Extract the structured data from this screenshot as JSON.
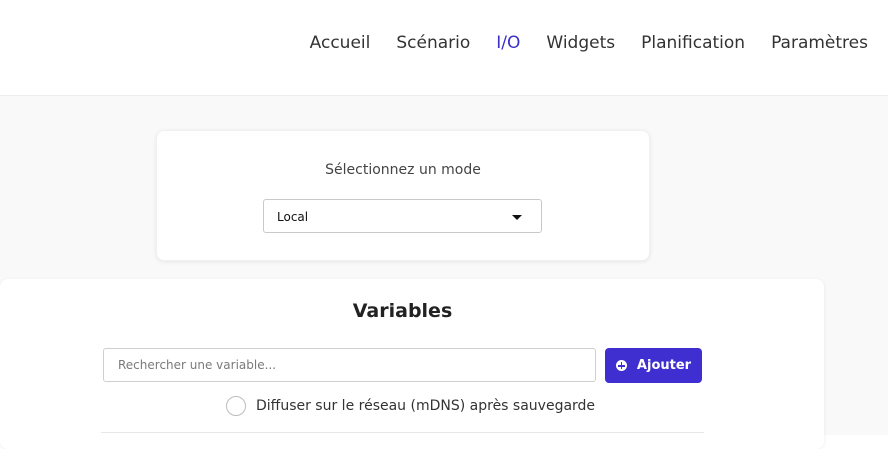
{
  "nav": {
    "items": [
      {
        "label": "Accueil"
      },
      {
        "label": "Scénario"
      },
      {
        "label": "I/O"
      },
      {
        "label": "Widgets"
      },
      {
        "label": "Planification"
      },
      {
        "label": "Paramètres"
      }
    ],
    "active": "I/O"
  },
  "mode": {
    "label": "Sélectionnez un mode",
    "selected": "Local"
  },
  "variables": {
    "title": "Variables",
    "search_placeholder": "Rechercher une variable...",
    "add_label": "Ajouter",
    "mdns_label": "Diffuser sur le réseau (mDNS) après sauvegarde",
    "mdns_checked": false
  },
  "colors": {
    "accent": "#3f2fd1",
    "nav_active": "#3b2fc9"
  }
}
